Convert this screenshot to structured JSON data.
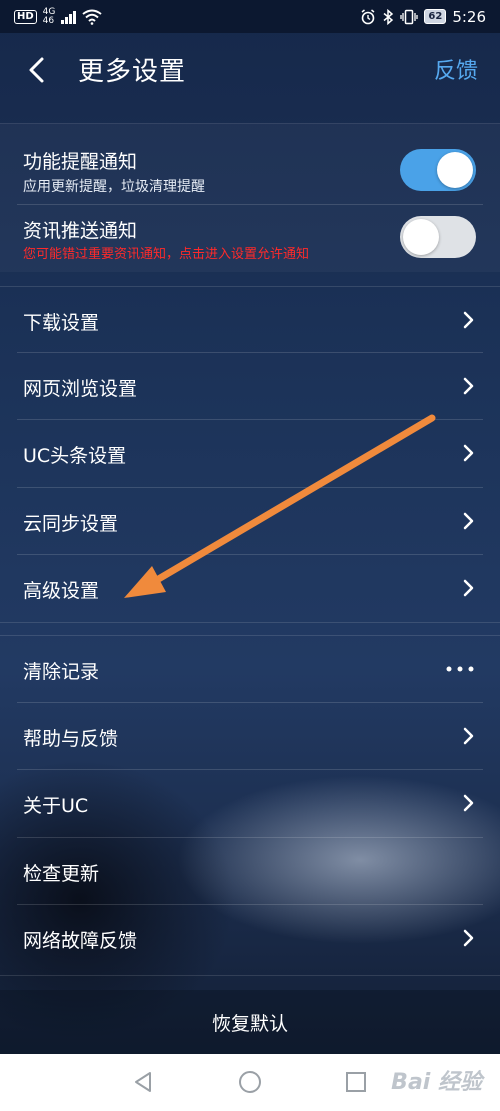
{
  "status_bar": {
    "hd": "HD",
    "net_top": "4G",
    "net_bottom": "46",
    "battery": "62",
    "time": "5:26"
  },
  "header": {
    "title": "更多设置",
    "feedback": "反馈"
  },
  "notifications": [
    {
      "label": "功能提醒通知",
      "sub": "应用更新提醒，垃圾清理提醒",
      "enabled": true
    },
    {
      "label": "资讯推送通知",
      "sub": "您可能错过重要资讯通知，点击进入设置允许通知",
      "enabled": false
    }
  ],
  "settings_group": [
    {
      "label": "下载设置"
    },
    {
      "label": "网页浏览设置"
    },
    {
      "label": "UC头条设置"
    },
    {
      "label": "云同步设置"
    },
    {
      "label": "高级设置"
    }
  ],
  "misc_group": [
    {
      "label": "清除记录",
      "accessory": "more"
    },
    {
      "label": "帮助与反馈",
      "accessory": "chevron"
    },
    {
      "label": "关于UC",
      "accessory": "chevron"
    },
    {
      "label": "检查更新",
      "accessory": "none"
    },
    {
      "label": "网络故障反馈",
      "accessory": "chevron"
    }
  ],
  "restore_default": "恢复默认",
  "watermark": "Bai 经验",
  "colors": {
    "accent": "#56a9f0",
    "toggle_on": "#4aa2e8",
    "warning": "#ff2a2a",
    "annotation_arrow": "#f08a3c"
  }
}
